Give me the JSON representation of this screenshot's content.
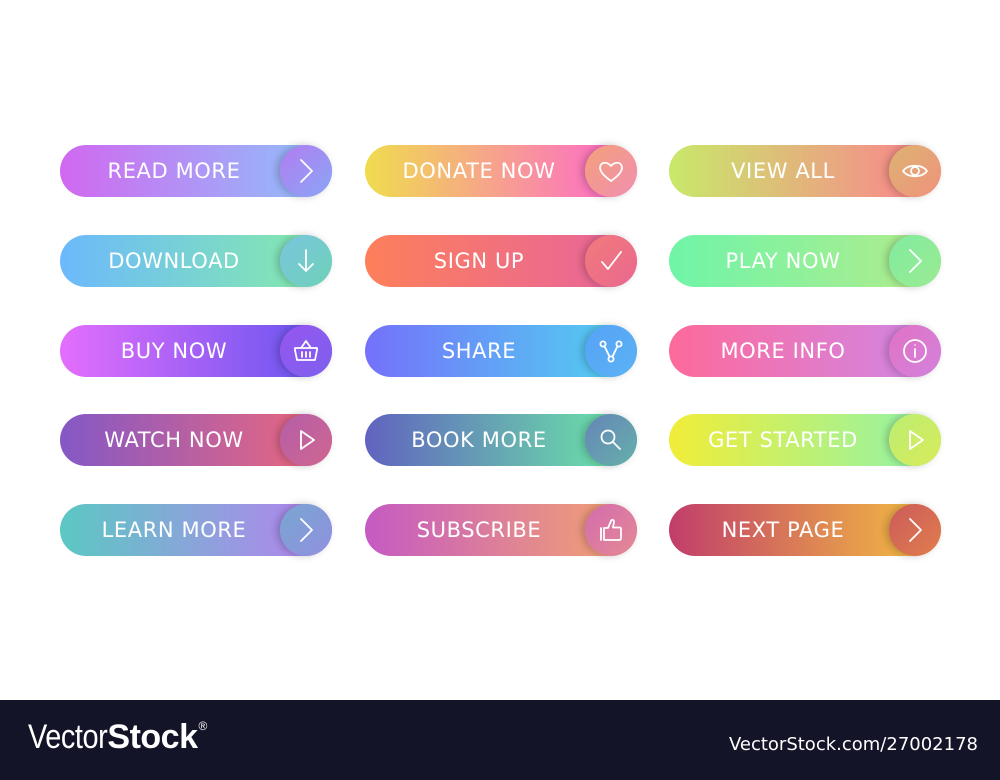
{
  "buttons": [
    {
      "label": "READ MORE",
      "icon": "chevron-right-icon",
      "bar": [
        "#d168f0",
        "#8ec3fb"
      ],
      "circle": [
        "#b27cf0",
        "#8aa6f6"
      ]
    },
    {
      "label": "DONATE NOW",
      "icon": "heart-icon",
      "bar": [
        "#f0dc4e",
        "#fe62d2"
      ],
      "circle": [
        "#f4a07a",
        "#f08fb0"
      ]
    },
    {
      "label": "VIEW ALL",
      "icon": "eye-icon",
      "bar": [
        "#c8e96a",
        "#fd7f8e"
      ],
      "circle": [
        "#dcb472",
        "#f0927c"
      ]
    },
    {
      "label": "DOWNLOAD",
      "icon": "arrow-down-icon",
      "bar": [
        "#6cb9fc",
        "#86eda8"
      ],
      "circle": [
        "#7ac4dd",
        "#6ed2b8"
      ]
    },
    {
      "label": "SIGN UP",
      "icon": "checkmark-icon",
      "bar": [
        "#fd7f5a",
        "#e7649e"
      ],
      "circle": [
        "#f27a7c",
        "#e8688e"
      ]
    },
    {
      "label": "PLAY NOW",
      "icon": "chevron-right-icon",
      "bar": [
        "#6ff4a8",
        "#b3ec8c"
      ],
      "circle": [
        "#80eba0",
        "#9beb92"
      ]
    },
    {
      "label": "BUY NOW",
      "icon": "basket-icon",
      "bar": [
        "#e46efd",
        "#6154ee"
      ],
      "circle": [
        "#9656f0",
        "#7d60ee"
      ]
    },
    {
      "label": "SHARE",
      "icon": "share-icon",
      "bar": [
        "#7471fb",
        "#4fd6f0"
      ],
      "circle": [
        "#56a2f6",
        "#5cb2f4"
      ]
    },
    {
      "label": "MORE INFO",
      "icon": "info-icon",
      "bar": [
        "#fd6a9b",
        "#ce88e9"
      ],
      "circle": [
        "#e072c4",
        "#d482dc"
      ]
    },
    {
      "label": "WATCH NOW",
      "icon": "play-icon",
      "bar": [
        "#8458c6",
        "#f0687a"
      ],
      "circle": [
        "#b45ea8",
        "#d06690"
      ]
    },
    {
      "label": "BOOK MORE",
      "icon": "search-icon",
      "bar": [
        "#6163bf",
        "#6beda6"
      ],
      "circle": [
        "#6685b8",
        "#65b0aa"
      ]
    },
    {
      "label": "GET STARTED",
      "icon": "play-icon",
      "bar": [
        "#f1ed38",
        "#8df4ae"
      ],
      "circle": [
        "#bced72",
        "#d8ec5a"
      ]
    },
    {
      "label": "LEARN MORE",
      "icon": "chevron-right-icon",
      "bar": [
        "#5bc8c3",
        "#b980f1"
      ],
      "circle": [
        "#78a6d0",
        "#9190e0"
      ]
    },
    {
      "label": "SUBSCRIBE",
      "icon": "thumbs-up-icon",
      "bar": [
        "#c55ac3",
        "#f5a66e"
      ],
      "circle": [
        "#d46cae",
        "#e48a94"
      ]
    },
    {
      "label": "NEXT PAGE",
      "icon": "chevron-right-icon",
      "bar": [
        "#c13d6b",
        "#f6c43f"
      ],
      "circle": [
        "#cc5a5c",
        "#e07e4c"
      ]
    }
  ],
  "footer": {
    "logo_light": "Vector",
    "logo_bold": "Stock",
    "logo_mark": "®",
    "url": "VectorStock.com/27002178"
  }
}
